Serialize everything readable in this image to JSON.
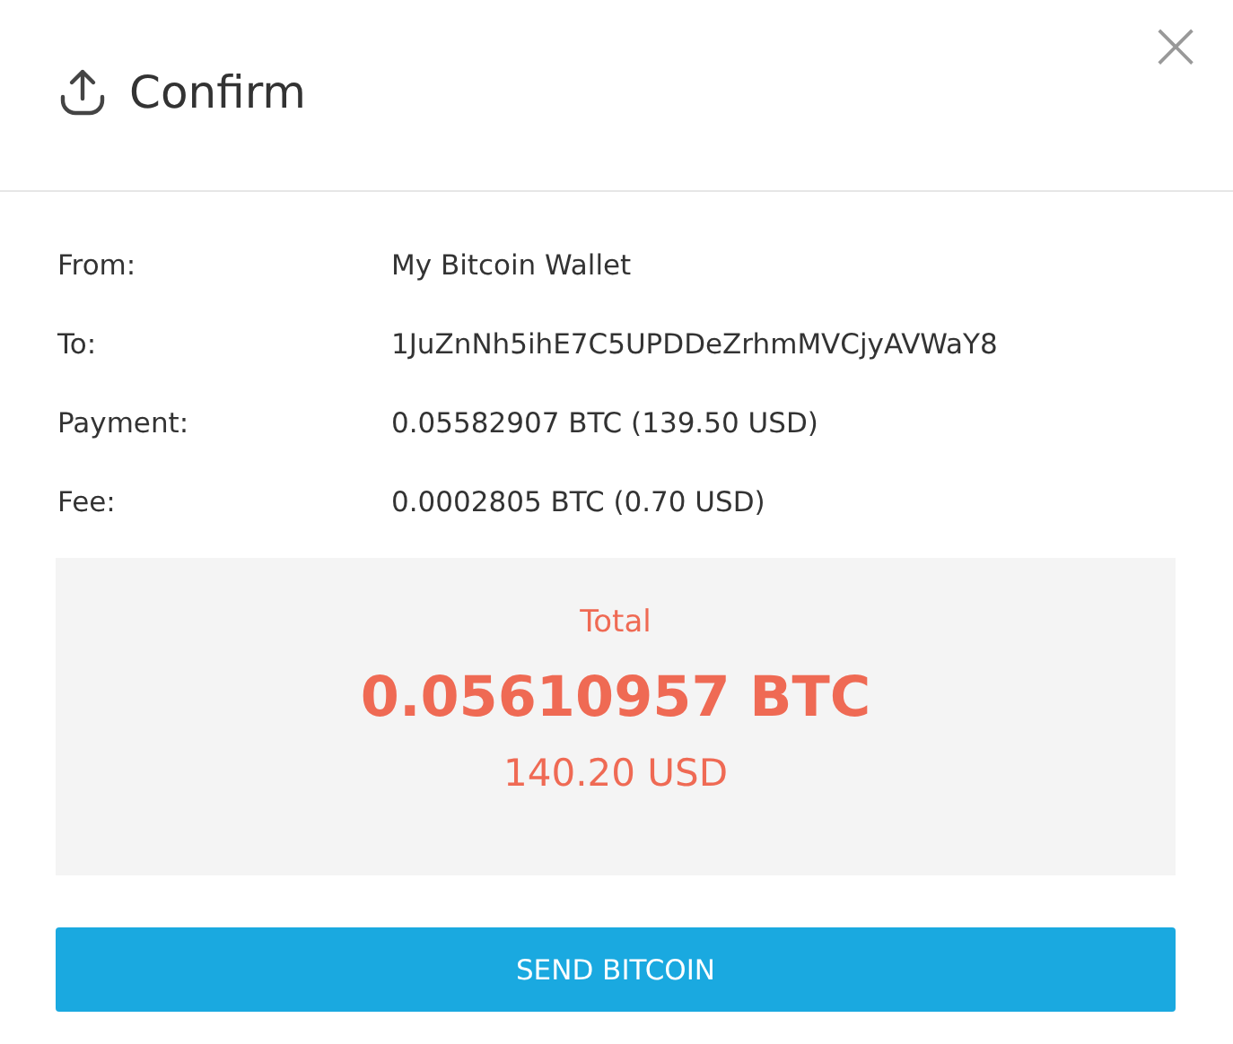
{
  "dialog": {
    "title": "Confirm",
    "close": "×"
  },
  "details": [
    {
      "label": "From:",
      "value": "My Bitcoin Wallet"
    },
    {
      "label": "To:",
      "value": "1JuZnNh5ihE7C5UPDDeZrhmMVCjyAVWaY8"
    },
    {
      "label": "Payment:",
      "value": "0.05582907 BTC (139.50 USD)"
    },
    {
      "label": "Fee:",
      "value": "0.0002805 BTC (0.70 USD)"
    }
  ],
  "total": {
    "label": "Total",
    "amount": "0.05610957 BTC",
    "fiat": "140.20 USD"
  },
  "button": "SEND BITCOIN"
}
